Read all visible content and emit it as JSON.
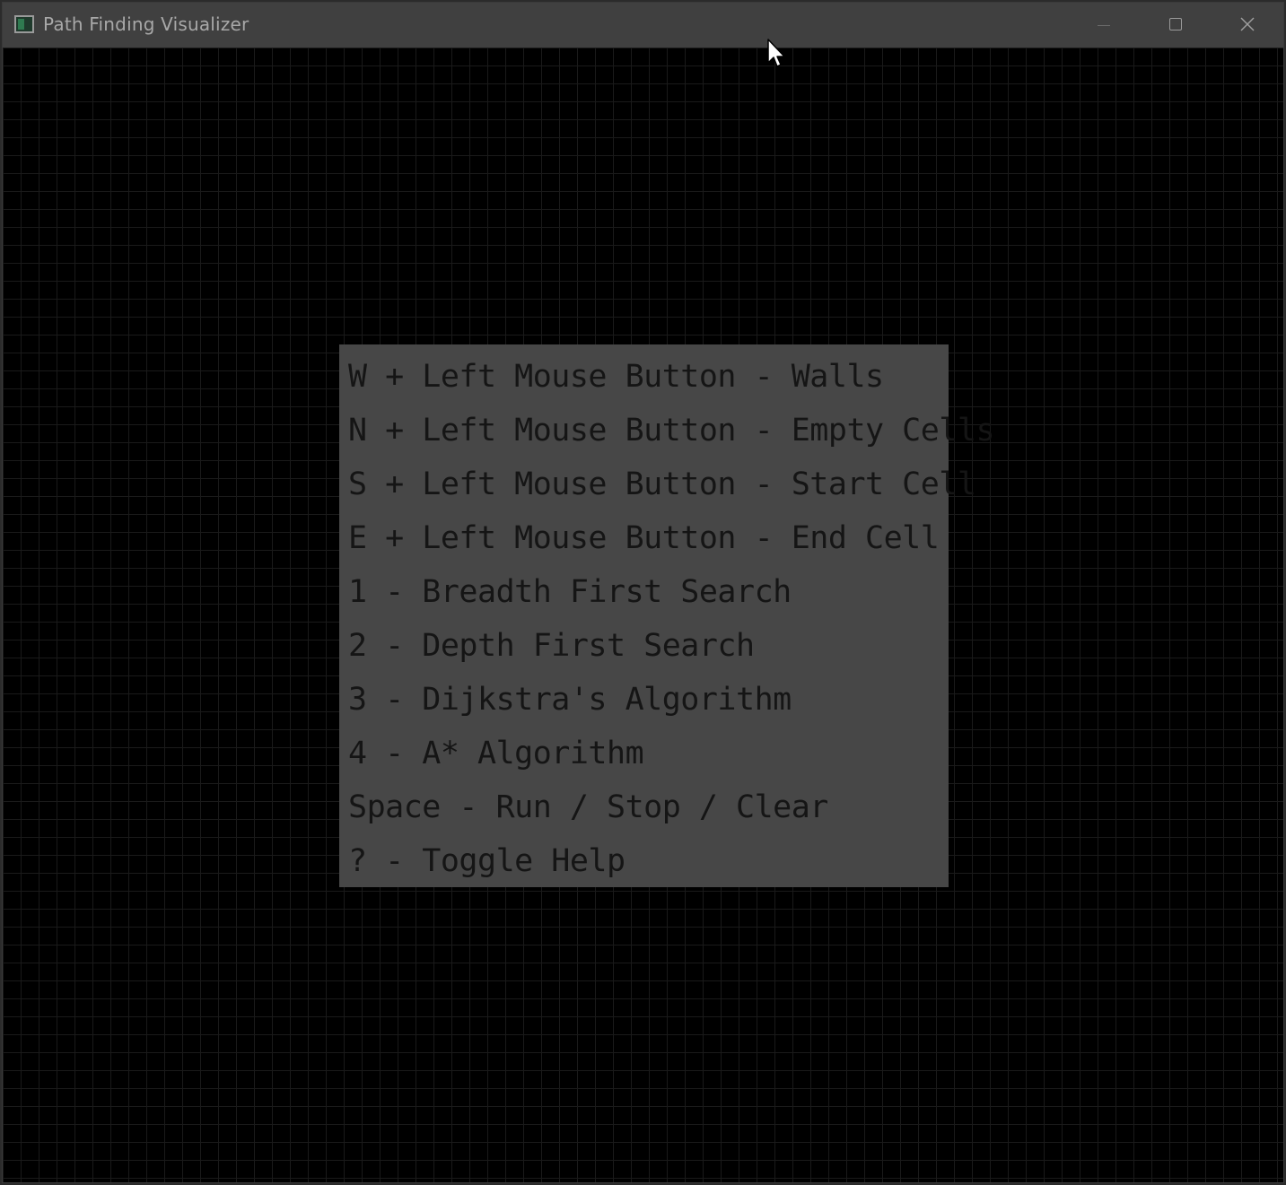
{
  "window": {
    "title": "Path Finding Visualizer",
    "controls": [
      "minimize-icon",
      "maximize-icon",
      "close-icon"
    ]
  },
  "grid": {
    "background_color": "#000000",
    "line_color": "#1a1a1a"
  },
  "help_panel": {
    "background_color": "#474747",
    "text_color": "#151515",
    "lines": [
      "W + Left Mouse Button - Walls",
      "N + Left Mouse Button - Empty Cells",
      "S + Left Mouse Button - Start Cell",
      "E + Left Mouse Button - End Cell",
      "1 - Breadth First Search",
      "2 - Depth First Search",
      "3 - Dijkstra's Algorithm",
      "4 - A* Algorithm",
      "Space - Run / Stop / Clear",
      "? - Toggle Help"
    ]
  }
}
